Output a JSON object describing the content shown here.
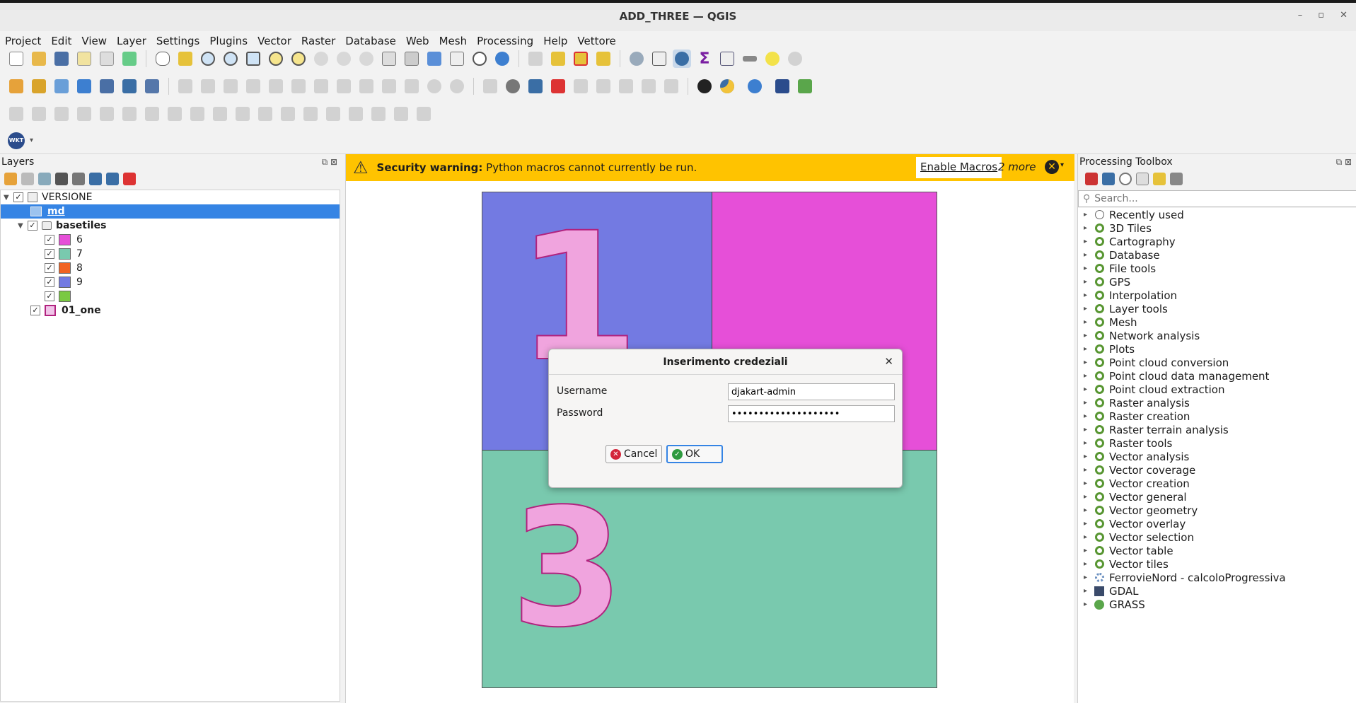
{
  "window": {
    "title": "ADD_THREE — QGIS",
    "controls": [
      "–",
      "▫",
      "✕"
    ]
  },
  "menu": [
    "Project",
    "Edit",
    "View",
    "Layer",
    "Settings",
    "Plugins",
    "Vector",
    "Raster",
    "Database",
    "Web",
    "Mesh",
    "Processing",
    "Help",
    "Vettore"
  ],
  "toolbar4": {
    "wkt_label": "WKT"
  },
  "layers_panel": {
    "title": "Layers",
    "rows": [
      {
        "label": "VERSIONE",
        "level": 0
      },
      {
        "label": "md",
        "level": 1,
        "selected": true
      },
      {
        "label": "basetiles",
        "level": 1
      },
      {
        "label": "6",
        "level": 2,
        "color": "#e64fd8"
      },
      {
        "label": "7",
        "level": 2,
        "color": "#79c9ae"
      },
      {
        "label": "8",
        "level": 2,
        "color": "#f16322"
      },
      {
        "label": "9",
        "level": 2,
        "color": "#737ae2"
      },
      {
        "label": "",
        "level": 2,
        "color": "#7ac943"
      },
      {
        "label": "01_one",
        "level": 1
      }
    ]
  },
  "warning": {
    "title": "Security warning:",
    "message": "Python macros cannot currently be run.",
    "enable_label": "Enable Macros",
    "more_label": "2 more"
  },
  "map": {
    "digit_one": "1",
    "digit_three": "3",
    "colors": {
      "top_left": "#737ae2",
      "top_right": "#e64fd8",
      "bottom": "#79c9ae"
    }
  },
  "dialog": {
    "title": "Inserimento credeziali",
    "username_label": "Username",
    "username_value": "djakart-admin",
    "password_label": "Password",
    "password_value": "••••••••••••••••••••",
    "cancel_label": "Cancel",
    "ok_label": "OK"
  },
  "toolbox": {
    "title": "Processing Toolbox",
    "search_placeholder": "Search...",
    "items": [
      "Recently used",
      "3D Tiles",
      "Cartography",
      "Database",
      "File tools",
      "GPS",
      "Interpolation",
      "Layer tools",
      "Mesh",
      "Network analysis",
      "Plots",
      "Point cloud conversion",
      "Point cloud data management",
      "Point cloud extraction",
      "Raster analysis",
      "Raster creation",
      "Raster terrain analysis",
      "Raster tools",
      "Vector analysis",
      "Vector coverage",
      "Vector creation",
      "Vector general",
      "Vector geometry",
      "Vector overlay",
      "Vector selection",
      "Vector table",
      "Vector tiles",
      "FerrovieNord - calcoloProgressiva",
      "GDAL",
      "GRASS"
    ]
  }
}
